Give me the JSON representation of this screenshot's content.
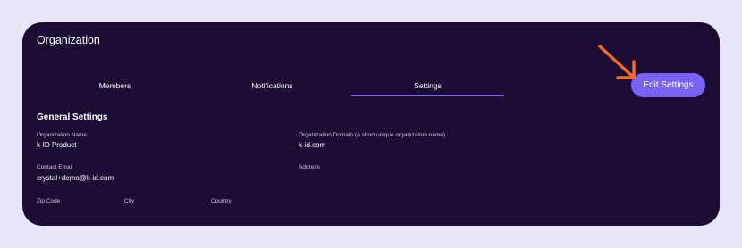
{
  "header": {
    "title": "Organization"
  },
  "tabs": [
    {
      "label": "Members",
      "active": false
    },
    {
      "label": "Notifications",
      "active": false
    },
    {
      "label": "Settings",
      "active": true
    }
  ],
  "actions": {
    "edit_label": "Edit Settings"
  },
  "general": {
    "title": "General Settings",
    "fields": {
      "org_name": {
        "label": "Organization Name",
        "value": "k-ID Product"
      },
      "org_domain": {
        "label": "Organization Domain (A short unique organization name)",
        "value": "k-id.com"
      },
      "contact_email": {
        "label": "Contact Email",
        "value": "crystal+demo@k-id.com"
      },
      "address": {
        "label": "Address",
        "value": ""
      },
      "zip_code": {
        "label": "Zip Code",
        "value": ""
      },
      "city": {
        "label": "City",
        "value": ""
      },
      "country": {
        "label": "Country",
        "value": ""
      }
    }
  },
  "colors": {
    "page_bg": "#e9e6fb",
    "card_bg": "#1a0c33",
    "accent": "#7a63f4",
    "annotation_arrow": "#f26c21"
  },
  "icons": {
    "annotation": "arrow-pointer-icon"
  }
}
